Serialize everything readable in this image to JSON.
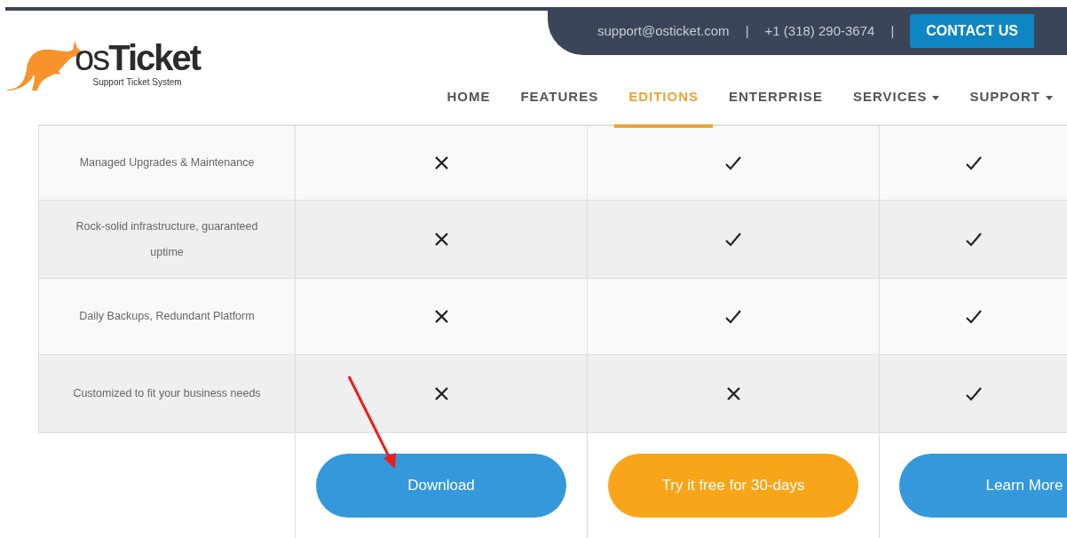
{
  "top_bar": {
    "email": "support@osticket.com",
    "separator": "|",
    "phone": "+1 (318) 290-3674",
    "separator_2": "|",
    "contact_button": "CONTACT US"
  },
  "logo": {
    "name_prefix": "os",
    "name": "Ticket",
    "tagline": "Support Ticket System"
  },
  "nav": [
    {
      "label": "HOME",
      "selected": false,
      "dropdown": false
    },
    {
      "label": "FEATURES",
      "selected": false,
      "dropdown": false
    },
    {
      "label": "EDITIONS",
      "selected": true,
      "dropdown": false
    },
    {
      "label": "ENTERPRISE",
      "selected": false,
      "dropdown": false
    },
    {
      "label": "SERVICES",
      "selected": false,
      "dropdown": true
    },
    {
      "label": "SUPPORT",
      "selected": false,
      "dropdown": true
    }
  ],
  "comparison": {
    "rows": [
      {
        "feature": "Managed Upgrades & Maintenance",
        "included": [
          false,
          true,
          true
        ]
      },
      {
        "feature": "Rock-solid infrastructure, guaranteed uptime",
        "included": [
          false,
          true,
          true
        ]
      },
      {
        "feature": "Daily Backups, Redundant Platform",
        "included": [
          false,
          true,
          true
        ]
      },
      {
        "feature": "Customized to fit your business needs",
        "included": [
          false,
          false,
          true
        ]
      }
    ],
    "buttons": [
      {
        "label": "Download",
        "color": "#3498db"
      },
      {
        "label": "Try it free for 30-days",
        "color": "#f9a51a"
      },
      {
        "label": "Learn More",
        "color": "#3498db"
      }
    ]
  }
}
